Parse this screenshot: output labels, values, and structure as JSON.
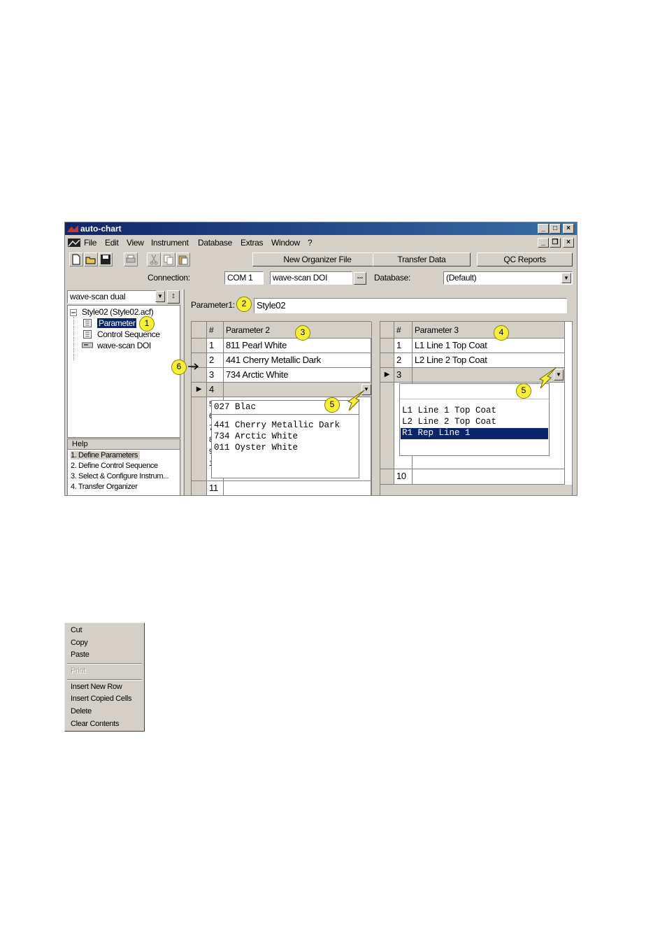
{
  "window": {
    "title": "auto-chart",
    "controls": {
      "minimize": "_",
      "maximize": "□",
      "close": "×",
      "restore": "❐"
    }
  },
  "menu": [
    "File",
    "Edit",
    "View",
    "Instrument",
    "Database",
    "Extras",
    "Window",
    "?"
  ],
  "toolbar": {
    "new_organizer": "New Organizer File",
    "transfer": "Transfer Data",
    "qc_reports": "QC Reports"
  },
  "connection": {
    "label": "Connection:",
    "port": "COM 1",
    "device": "wave-scan DOI",
    "browse": "...",
    "database_label": "Database:",
    "database_value": "(Default)"
  },
  "left": {
    "instrument": "wave-scan dual",
    "tree": {
      "root": "Style02 (Style02.acf)",
      "items": [
        "Parameter",
        "Control Sequence",
        "wave-scan DOI"
      ]
    },
    "help": {
      "title": "Help",
      "items": [
        "1. Define Parameters",
        "2. Define Control Sequence",
        "3. Select & Configure Instrum...",
        "4. Transfer Organizer"
      ]
    }
  },
  "parameter1": {
    "label": "Parameter1:",
    "value": "Style02"
  },
  "grid2": {
    "col_num": "#",
    "col_name": "Parameter 2",
    "rows": [
      {
        "n": "1",
        "v": "811 Pearl White"
      },
      {
        "n": "2",
        "v": "441 Cherry Metallic Dark"
      },
      {
        "n": "3",
        "v": "734 Arctic White"
      },
      {
        "n": "4",
        "v": ""
      }
    ],
    "extra_rows": [
      "11"
    ],
    "partial_rows": [
      "5",
      "6",
      "7",
      "8",
      "9",
      "1"
    ],
    "input": "027 Blac",
    "suggestions": [
      "441 Cherry Metallic Dark",
      "734 Arctic White",
      "011 Oyster White"
    ]
  },
  "grid3": {
    "col_num": "#",
    "col_name": "Parameter 3",
    "rows": [
      {
        "n": "1",
        "v": "L1 Line 1 Top Coat"
      },
      {
        "n": "2",
        "v": "L2 Line 2 Top Coat"
      },
      {
        "n": "3",
        "v": ""
      }
    ],
    "last_row": "10",
    "suggestions": [
      "L1 Line 1 Top Coat",
      "L2 Line 2 Top Coat",
      "R1 Rep Line 1"
    ]
  },
  "callouts": [
    "1",
    "2",
    "3",
    "4",
    "5",
    "5",
    "6"
  ],
  "context_menu": {
    "items": [
      "Cut",
      "Copy",
      "Paste",
      "Print",
      "Insert New Row",
      "Insert Copied Cells",
      "Delete",
      "Clear Contents"
    ]
  },
  "colors": {
    "selection": "#0a246a",
    "callout": "#f6ef3b",
    "face": "#d4d0c8"
  }
}
